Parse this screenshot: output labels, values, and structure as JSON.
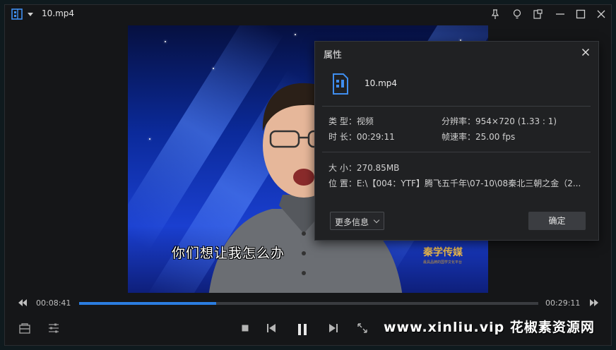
{
  "window": {
    "title": "10.mp4"
  },
  "video": {
    "subtitle": "你们想让我怎么办",
    "watermark": "秦学传媒",
    "watermark_sub": "最具品牌的国学文化平台"
  },
  "properties_dialog": {
    "title": "属性",
    "file_name": "10.mp4",
    "type_label": "类 型：",
    "type_value": "视频",
    "resolution_label": "分辨率：",
    "resolution_value": "954×720 (1.33 : 1)",
    "duration_label": "时 长：",
    "duration_value": "00:29:11",
    "framerate_label": "帧速率：",
    "framerate_value": "25.00 fps",
    "size_label": "大 小：",
    "size_value": "270.85MB",
    "location_label": "位 置：",
    "location_value": "E:\\【004：YTF】腾飞五千年\\07-10\\08秦北三朝之金（2...",
    "more_info_button": "更多信息",
    "ok_button": "确定"
  },
  "playback": {
    "current_time": "00:08:41",
    "total_time": "00:29:11",
    "progress": 0.298
  },
  "branding": {
    "text": "www.xinliu.vip 花椒素资源网"
  },
  "colors": {
    "accent": "#2b7de0",
    "window_bg": "#151618",
    "dialog_bg": "#202123"
  },
  "icons": {
    "app": "player-logo-icon",
    "pin": "pin-icon",
    "bulb": "lightbulb-icon",
    "mini": "mini-window-icon",
    "minimize": "minimize-icon",
    "maximize": "maximize-icon",
    "close": "close-icon"
  }
}
